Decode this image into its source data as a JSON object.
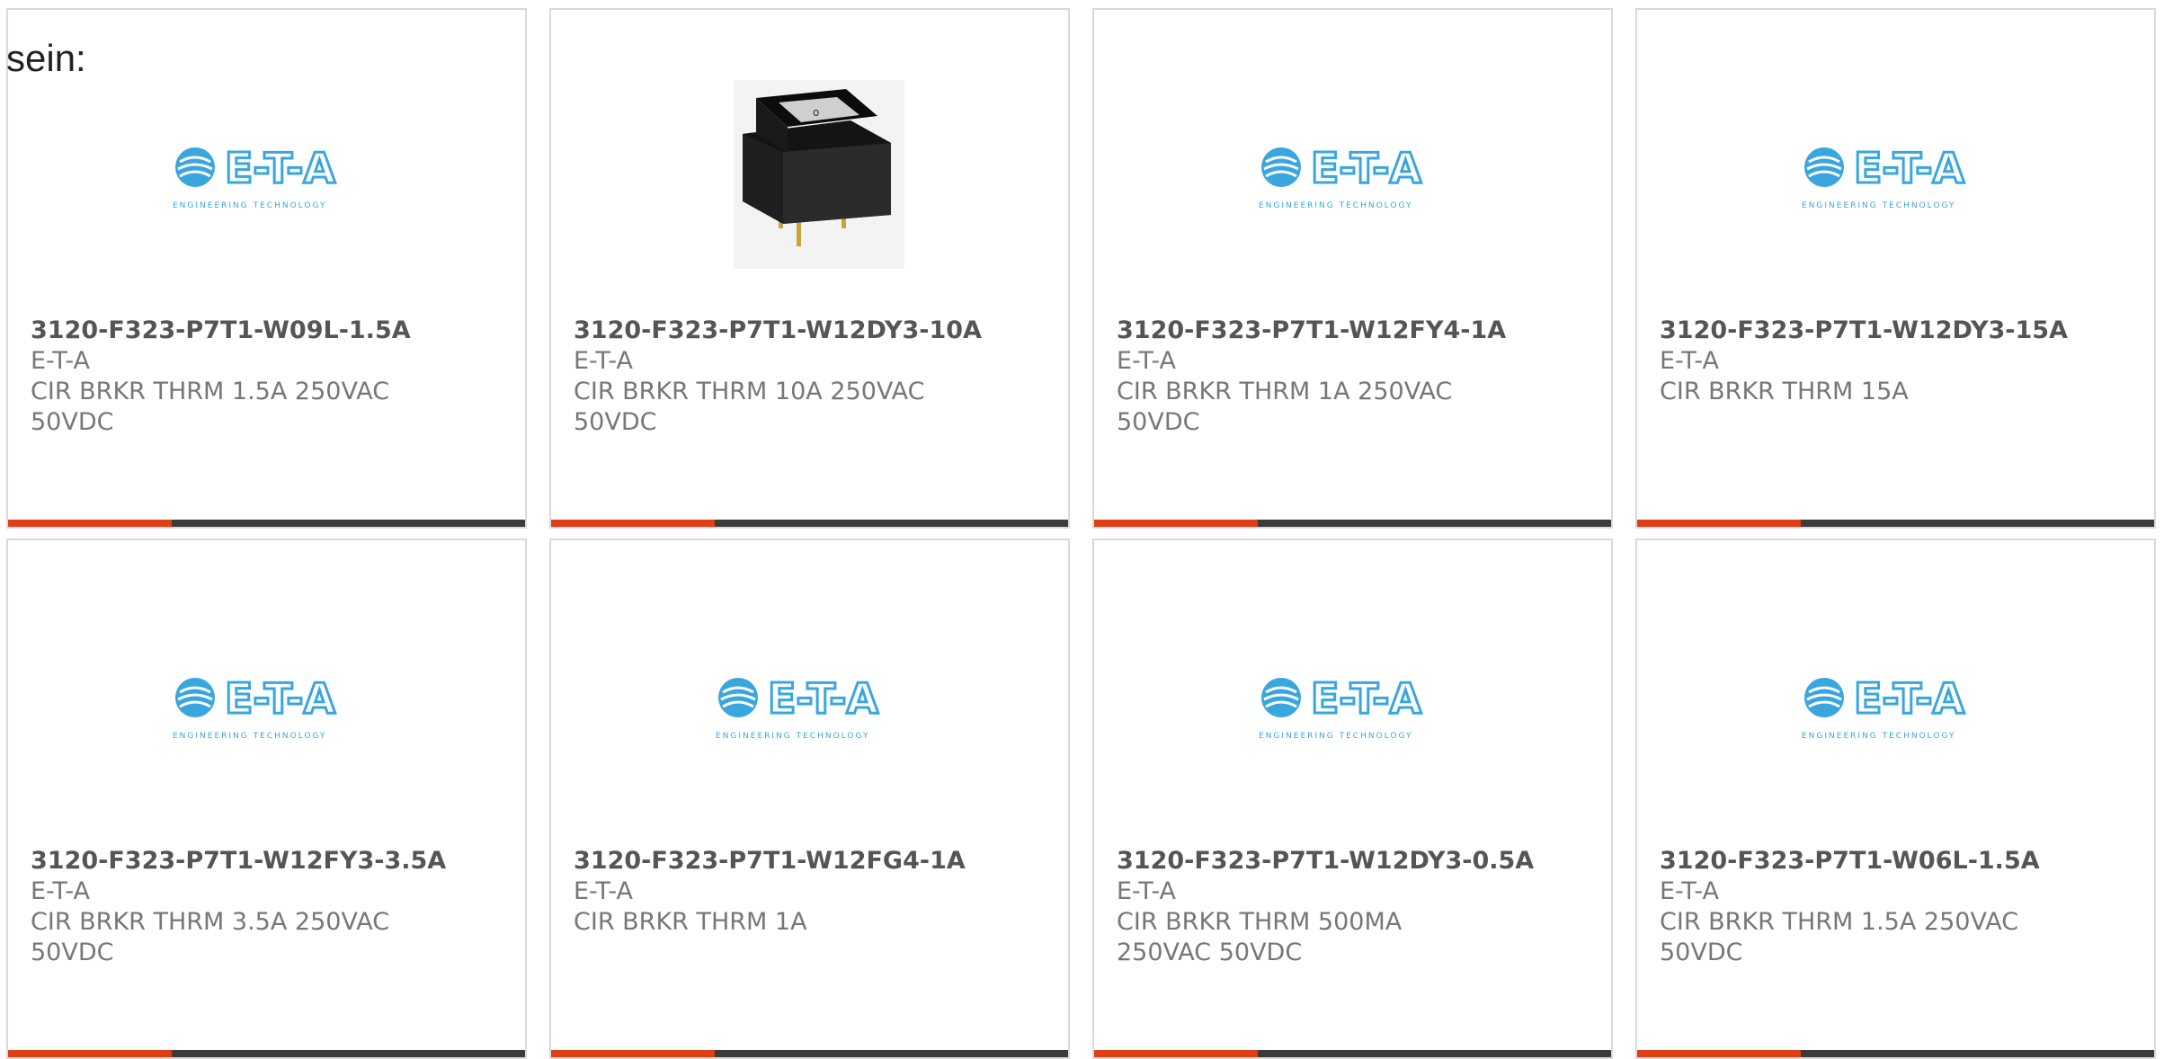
{
  "intro": {
    "text": "sein:"
  },
  "colors": {
    "accent": "#e03e14",
    "bar": "#3b3b3b",
    "border": "#d9d9d9",
    "logo_blue": "#3aa6de"
  },
  "cards": [
    {
      "part_number": "3120-F323-P7T1-W09L-1.5A",
      "manufacturer": "E-T-A",
      "description": "CIR BRKR THRM 1.5A 250VAC 50VDC",
      "image": "eta-logo",
      "logo_text": "E-T-A",
      "logo_tagline": "ENGINEERING TECHNOLOGY"
    },
    {
      "part_number": "3120-F323-P7T1-W12DY3-10A",
      "manufacturer": "E-T-A",
      "description": "CIR BRKR THRM 10A 250VAC 50VDC",
      "image": "rocker-switch-photo"
    },
    {
      "part_number": "3120-F323-P7T1-W12FY4-1A",
      "manufacturer": "E-T-A",
      "description": "CIR BRKR THRM 1A 250VAC 50VDC",
      "image": "eta-logo",
      "logo_text": "E-T-A",
      "logo_tagline": "ENGINEERING TECHNOLOGY"
    },
    {
      "part_number": "3120-F323-P7T1-W12DY3-15A",
      "manufacturer": "E-T-A",
      "description": "CIR BRKR THRM 15A",
      "image": "eta-logo",
      "logo_text": "E-T-A",
      "logo_tagline": "ENGINEERING TECHNOLOGY"
    },
    {
      "part_number": "3120-F323-P7T1-W12FY3-3.5A",
      "manufacturer": "E-T-A",
      "description": "CIR BRKR THRM 3.5A 250VAC 50VDC",
      "image": "eta-logo",
      "logo_text": "E-T-A",
      "logo_tagline": "ENGINEERING TECHNOLOGY"
    },
    {
      "part_number": "3120-F323-P7T1-W12FG4-1A",
      "manufacturer": "E-T-A",
      "description": "CIR BRKR THRM 1A",
      "image": "eta-logo",
      "logo_text": "E-T-A",
      "logo_tagline": "ENGINEERING TECHNOLOGY"
    },
    {
      "part_number": "3120-F323-P7T1-W12DY3-0.5A",
      "manufacturer": "E-T-A",
      "description": "CIR BRKR THRM 500MA 250VAC 50VDC",
      "image": "eta-logo",
      "logo_text": "E-T-A",
      "logo_tagline": "ENGINEERING TECHNOLOGY"
    },
    {
      "part_number": "3120-F323-P7T1-W06L-1.5A",
      "manufacturer": "E-T-A",
      "description": "CIR BRKR THRM 1.5A 250VAC 50VDC",
      "image": "eta-logo",
      "logo_text": "E-T-A",
      "logo_tagline": "ENGINEERING TECHNOLOGY"
    }
  ]
}
